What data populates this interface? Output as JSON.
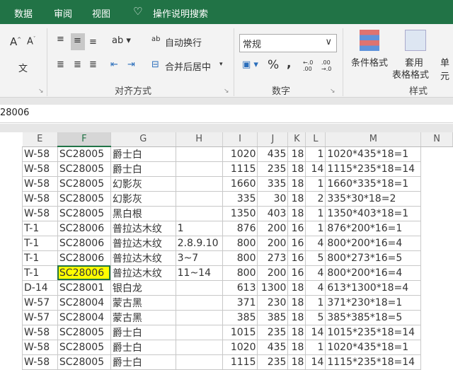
{
  "tabs": [
    "数据",
    "审阅",
    "视图"
  ],
  "tell_me": "操作说明搜索",
  "ribbon": {
    "wrap_text": "自动换行",
    "merge_center": "合并后居中",
    "alignment_group": "对齐方式",
    "number_format": "常规",
    "percent": "%",
    "comma": ",",
    "inc_decimal": "←.0 .00",
    "dec_decimal": ".00 →.0",
    "number_group": "数字",
    "cond_format": "条件格式",
    "table_format_1": "套用",
    "table_format_2": "表格格式",
    "cell_styles": "单元",
    "styles_group": "样式",
    "wen": "文"
  },
  "formula_bar": {
    "value": "28006"
  },
  "columns": [
    "E",
    "F",
    "G",
    "H",
    "I",
    "J",
    "K",
    "L",
    "M",
    "N"
  ],
  "rows": [
    [
      "W-58",
      "SC28005",
      "爵士白",
      "",
      "1020",
      "435",
      "18",
      "1",
      "1020*435*18=1"
    ],
    [
      "W-58",
      "SC28005",
      "爵士白",
      "",
      "1115",
      "235",
      "18",
      "14",
      "1115*235*18=14"
    ],
    [
      "W-58",
      "SC28005",
      "幻影灰",
      "",
      "1660",
      "335",
      "18",
      "1",
      "1660*335*18=1"
    ],
    [
      "W-58",
      "SC28005",
      "幻影灰",
      "",
      "335",
      "30",
      "18",
      "2",
      "335*30*18=2"
    ],
    [
      "W-58",
      "SC28005",
      "黑白根",
      "",
      "1350",
      "403",
      "18",
      "1",
      "1350*403*18=1"
    ],
    [
      "T-1",
      "SC28006",
      "普拉达木纹",
      "1",
      "876",
      "200",
      "16",
      "1",
      "876*200*16=1"
    ],
    [
      "T-1",
      "SC28006",
      "普拉达木纹",
      "2.8.9.10",
      "800",
      "200",
      "16",
      "4",
      "800*200*16=4"
    ],
    [
      "T-1",
      "SC28006",
      "普拉达木纹",
      "3~7",
      "800",
      "273",
      "16",
      "5",
      "800*273*16=5"
    ],
    [
      "T-1",
      "SC28006",
      "普拉达木纹",
      "11~14",
      "800",
      "200",
      "16",
      "4",
      "800*200*16=4"
    ],
    [
      "D-14",
      "SC28001",
      "银白龙",
      "",
      "613",
      "1300",
      "18",
      "4",
      "613*1300*18=4"
    ],
    [
      "W-57",
      "SC28004",
      "蒙古黑",
      "",
      "371",
      "230",
      "18",
      "1",
      "371*230*18=1"
    ],
    [
      "W-57",
      "SC28004",
      "蒙古黑",
      "",
      "385",
      "385",
      "18",
      "5",
      "385*385*18=5"
    ],
    [
      "W-58",
      "SC28005",
      "爵士白",
      "",
      "1015",
      "235",
      "18",
      "14",
      "1015*235*18=14"
    ],
    [
      "W-58",
      "SC28005",
      "爵士白",
      "",
      "1020",
      "435",
      "18",
      "1",
      "1020*435*18=1"
    ],
    [
      "W-58",
      "SC28005",
      "爵士白",
      "",
      "1115",
      "235",
      "18",
      "14",
      "1115*235*18=14"
    ]
  ],
  "active_cell": {
    "row": 8,
    "col": "F"
  },
  "colors": {
    "brand": "#217346",
    "highlight": "#ffff00"
  }
}
